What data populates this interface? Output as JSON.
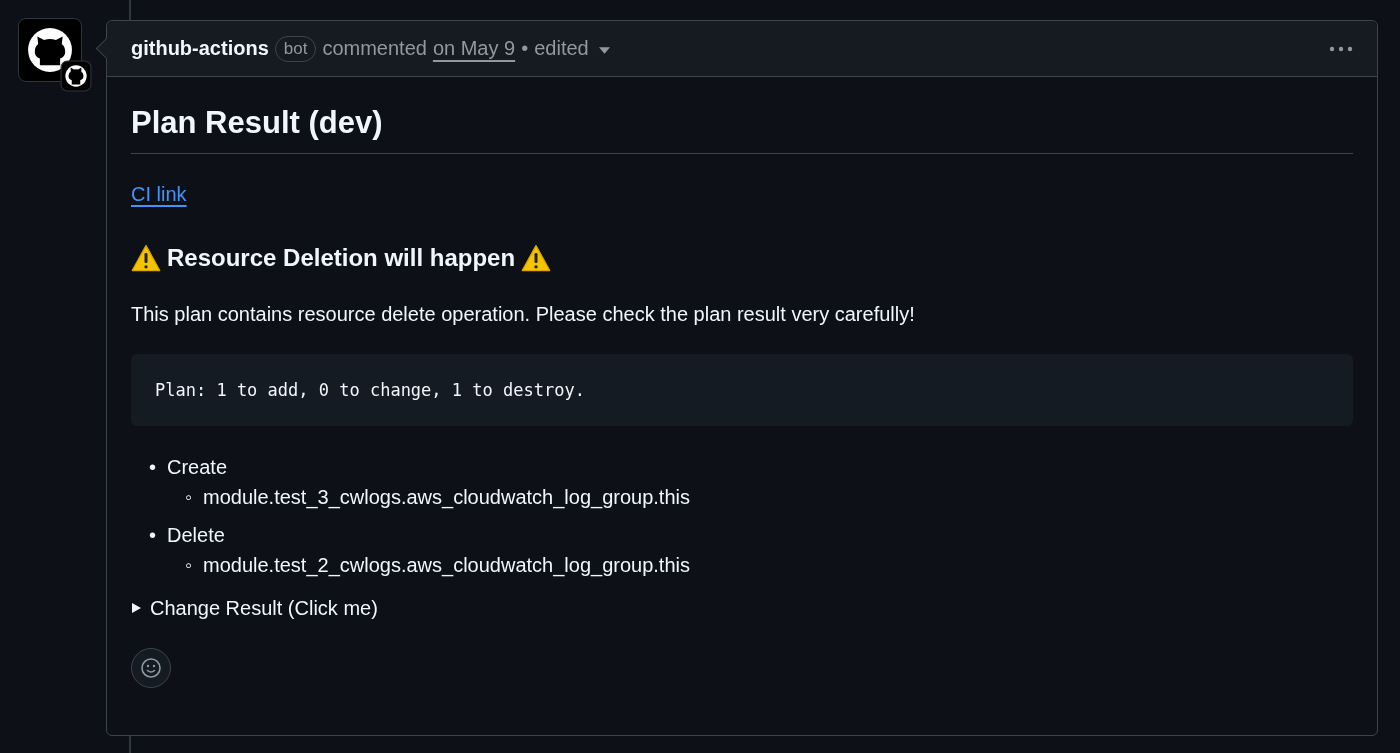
{
  "comment": {
    "author": "github-actions",
    "badge": "bot",
    "action": "commented",
    "date": "on May 9",
    "separator": "•",
    "edited": "edited"
  },
  "body": {
    "title": "Plan Result (dev)",
    "link": "CI link",
    "warning": "Resource Deletion will happen",
    "description": "This plan contains resource delete operation. Please check the plan result very carefully!",
    "code": "Plan: 1 to add, 0 to change, 1 to destroy.",
    "list": [
      {
        "marker": "•",
        "label": "Create",
        "children": [
          {
            "marker": "◦",
            "label": "module.test_3_cwlogs.aws_cloudwatch_log_group.this"
          }
        ]
      },
      {
        "marker": "•",
        "label": "Delete",
        "children": [
          {
            "marker": "◦",
            "label": "module.test_2_cwlogs.aws_cloudwatch_log_group.this"
          }
        ]
      }
    ],
    "details": {
      "summary": "Change Result (Click me)",
      "expanded": false
    }
  }
}
